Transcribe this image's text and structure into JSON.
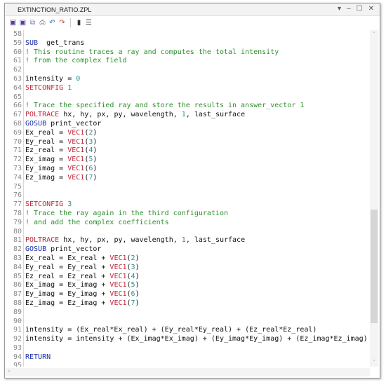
{
  "window": {
    "title": "EXTINCTION_RATIO.ZPL",
    "controls": [
      "▾",
      "–",
      "☐",
      "✕"
    ]
  },
  "toolbar": {
    "icons": [
      "save-icon",
      "save-as-icon",
      "copy-icon",
      "print-icon",
      "undo-icon",
      "redo-icon",
      "toggle-icon",
      "list-icon"
    ],
    "glyphs": [
      "▣",
      "▣",
      "⧉",
      "⎙",
      "↶",
      "↷",
      "▮",
      "☰"
    ],
    "colors": [
      "#5a3f9a",
      "#5a3f9a",
      "#6a7fb0",
      "#666",
      "#2a63c9",
      "#c03030",
      "#333",
      "#555"
    ]
  },
  "editor": {
    "lines": [
      {
        "n": "58",
        "t": []
      },
      {
        "n": "59",
        "t": [
          [
            "kw",
            "SUB"
          ],
          [
            "",
            "  get_trans"
          ]
        ]
      },
      {
        "n": "60",
        "t": [
          [
            "cmt",
            "! This routine traces a ray and computes the total intensity"
          ]
        ]
      },
      {
        "n": "61",
        "t": [
          [
            "cmt",
            "! from the complex field"
          ]
        ]
      },
      {
        "n": "62",
        "t": []
      },
      {
        "n": "63",
        "t": [
          [
            "",
            "intensity = "
          ],
          [
            "num",
            "0"
          ]
        ]
      },
      {
        "n": "64",
        "t": [
          [
            "cmd",
            "SETCONFIG"
          ],
          [
            "",
            ""
          ],
          [
            "num",
            " 1"
          ]
        ]
      },
      {
        "n": "65",
        "t": []
      },
      {
        "n": "66",
        "t": [
          [
            "cmt",
            "! Trace the specified ray and store the results in answer_vector 1"
          ]
        ]
      },
      {
        "n": "67",
        "t": [
          [
            "cmd",
            "POLTRACE"
          ],
          [
            "",
            " hx, hy, px, py, wavelength, "
          ],
          [
            "num",
            "1"
          ],
          [
            "",
            ", last_surface"
          ]
        ]
      },
      {
        "n": "68",
        "t": [
          [
            "kw",
            "GOSUB"
          ],
          [
            "",
            " print_vector"
          ]
        ]
      },
      {
        "n": "69",
        "t": [
          [
            "",
            "Ex_real = "
          ],
          [
            "cmd",
            "VEC1"
          ],
          [
            "",
            "("
          ],
          [
            "num",
            "2"
          ],
          [
            "",
            ")"
          ]
        ]
      },
      {
        "n": "70",
        "t": [
          [
            "",
            "Ey_real = "
          ],
          [
            "cmd",
            "VEC1"
          ],
          [
            "",
            "("
          ],
          [
            "num",
            "3"
          ],
          [
            "",
            ")"
          ]
        ]
      },
      {
        "n": "71",
        "t": [
          [
            "",
            "Ez_real = "
          ],
          [
            "cmd",
            "VEC1"
          ],
          [
            "",
            "("
          ],
          [
            "num",
            "4"
          ],
          [
            "",
            ")"
          ]
        ]
      },
      {
        "n": "72",
        "t": [
          [
            "",
            "Ex_imag = "
          ],
          [
            "cmd",
            "VEC1"
          ],
          [
            "",
            "("
          ],
          [
            "num",
            "5"
          ],
          [
            "",
            ")"
          ]
        ]
      },
      {
        "n": "73",
        "t": [
          [
            "",
            "Ey_imag = "
          ],
          [
            "cmd",
            "VEC1"
          ],
          [
            "",
            "("
          ],
          [
            "num",
            "6"
          ],
          [
            "",
            ")"
          ]
        ]
      },
      {
        "n": "74",
        "t": [
          [
            "",
            "Ez_imag = "
          ],
          [
            "cmd",
            "VEC1"
          ],
          [
            "",
            "("
          ],
          [
            "num",
            "7"
          ],
          [
            "",
            ")"
          ]
        ]
      },
      {
        "n": "75",
        "t": []
      },
      {
        "n": "76",
        "t": []
      },
      {
        "n": "77",
        "t": [
          [
            "cmd",
            "SETCONFIG"
          ],
          [
            "num",
            " 3"
          ]
        ]
      },
      {
        "n": "78",
        "t": [
          [
            "cmt",
            "! Trace the ray again in the third configuration"
          ]
        ]
      },
      {
        "n": "79",
        "t": [
          [
            "cmt",
            "! and add the complex coefficients"
          ]
        ]
      },
      {
        "n": "80",
        "t": []
      },
      {
        "n": "81",
        "t": [
          [
            "cmd",
            "POLTRACE"
          ],
          [
            "",
            " hx, hy, px, py, wavelength, "
          ],
          [
            "num",
            "1"
          ],
          [
            "",
            ", last_surface"
          ]
        ]
      },
      {
        "n": "82",
        "t": [
          [
            "kw",
            "GOSUB"
          ],
          [
            "",
            " print_vector"
          ]
        ]
      },
      {
        "n": "83",
        "t": [
          [
            "",
            "Ex_real = Ex_real + "
          ],
          [
            "cmd",
            "VEC1"
          ],
          [
            "",
            "("
          ],
          [
            "num",
            "2"
          ],
          [
            "",
            ")"
          ]
        ]
      },
      {
        "n": "84",
        "t": [
          [
            "",
            "Ey_real = Ey_real + "
          ],
          [
            "cmd",
            "VEC1"
          ],
          [
            "",
            "("
          ],
          [
            "num",
            "3"
          ],
          [
            "",
            ")"
          ]
        ]
      },
      {
        "n": "85",
        "t": [
          [
            "",
            "Ez_real = Ez_real + "
          ],
          [
            "cmd",
            "VEC1"
          ],
          [
            "",
            "("
          ],
          [
            "num",
            "4"
          ],
          [
            "",
            ")"
          ]
        ]
      },
      {
        "n": "86",
        "t": [
          [
            "",
            "Ex_imag = Ex_imag + "
          ],
          [
            "cmd",
            "VEC1"
          ],
          [
            "",
            "("
          ],
          [
            "num",
            "5"
          ],
          [
            "",
            ")"
          ]
        ]
      },
      {
        "n": "87",
        "t": [
          [
            "",
            "Ey_imag = Ey_imag + "
          ],
          [
            "cmd",
            "VEC1"
          ],
          [
            "",
            "("
          ],
          [
            "num",
            "6"
          ],
          [
            "",
            ")"
          ]
        ]
      },
      {
        "n": "88",
        "t": [
          [
            "",
            "Ez_imag = Ez_imag + "
          ],
          [
            "cmd",
            "VEC1"
          ],
          [
            "",
            "("
          ],
          [
            "num",
            "7"
          ],
          [
            "",
            ")"
          ]
        ]
      },
      {
        "n": "89",
        "t": []
      },
      {
        "n": "90",
        "t": []
      },
      {
        "n": "91",
        "t": [
          [
            "",
            "intensity = (Ex_real*Ex_real) + (Ey_real*Ey_real) + (Ez_real*Ez_real)"
          ]
        ]
      },
      {
        "n": "92",
        "t": [
          [
            "",
            "intensity = intensity + (Ex_imag*Ex_imag) + (Ey_imag*Ey_imag) + (Ez_imag*Ez_imag)"
          ]
        ]
      },
      {
        "n": "93",
        "t": []
      },
      {
        "n": "94",
        "t": [
          [
            "kw",
            "RETURN"
          ]
        ]
      },
      {
        "n": "95",
        "t": []
      }
    ]
  },
  "scrollbar": {
    "up": "˄",
    "down": "˅",
    "right": "›"
  }
}
